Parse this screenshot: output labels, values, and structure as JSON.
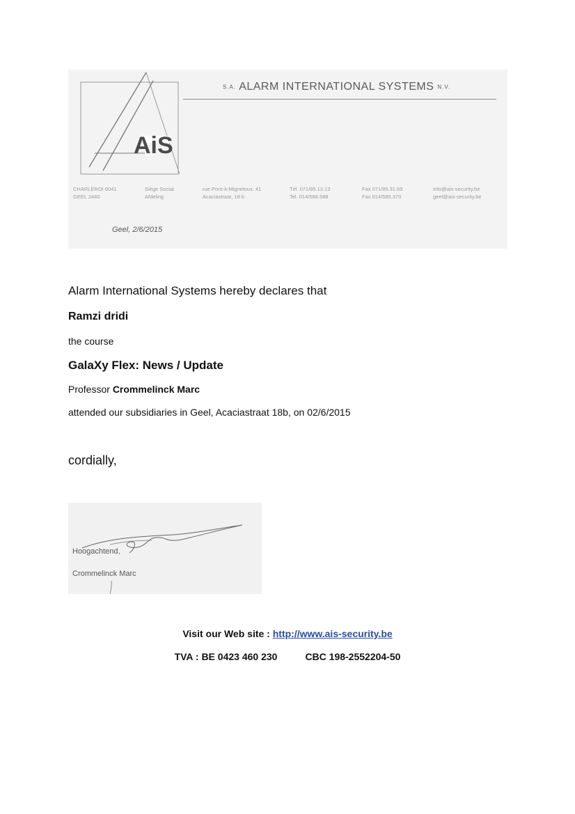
{
  "letterhead": {
    "prefix": "S.A.",
    "company": "ALARM INTERNATIONAL SYSTEMS",
    "suffix": "N.V.",
    "logo_text": "AiS",
    "col1": [
      "CHARLEROI 6041",
      "GEEL 2440"
    ],
    "col2": [
      "Siège Social",
      "Afdeling"
    ],
    "col3": [
      "rue Pont-à-Migneloux, 41",
      "Acaciastraat, 18 b"
    ],
    "col4": [
      "Tél. 071/85.13.13",
      "Tel. 014/588.588"
    ],
    "col5": [
      "Fax 071/85.31.69",
      "Fax 014/585.370"
    ],
    "col6": [
      "info@ais-security.be",
      "geel@ais-security.be"
    ],
    "date": "Geel, 2/6/2015"
  },
  "body": {
    "intro": "Alarm International Systems hereby declares that",
    "name": "Ramzi dridi",
    "course_label": "the course",
    "course": "GalaXy Flex: News / Update",
    "professor_label": "Professor",
    "professor_name": "Crommelinck Marc",
    "attended": "attended our subsidiaries in Geel, Acaciastraat 18b, on 02/6/2015",
    "closing": "cordially,"
  },
  "signature": {
    "line1": "Hoogachtend,",
    "line2": "Crommelinck Marc"
  },
  "footer": {
    "web_label": "Visit our Web site :",
    "web_url": "http://www.ais-security.be",
    "tva": "TVA : BE 0423 460 230",
    "cbc": "CBC  198-2552204-50"
  }
}
